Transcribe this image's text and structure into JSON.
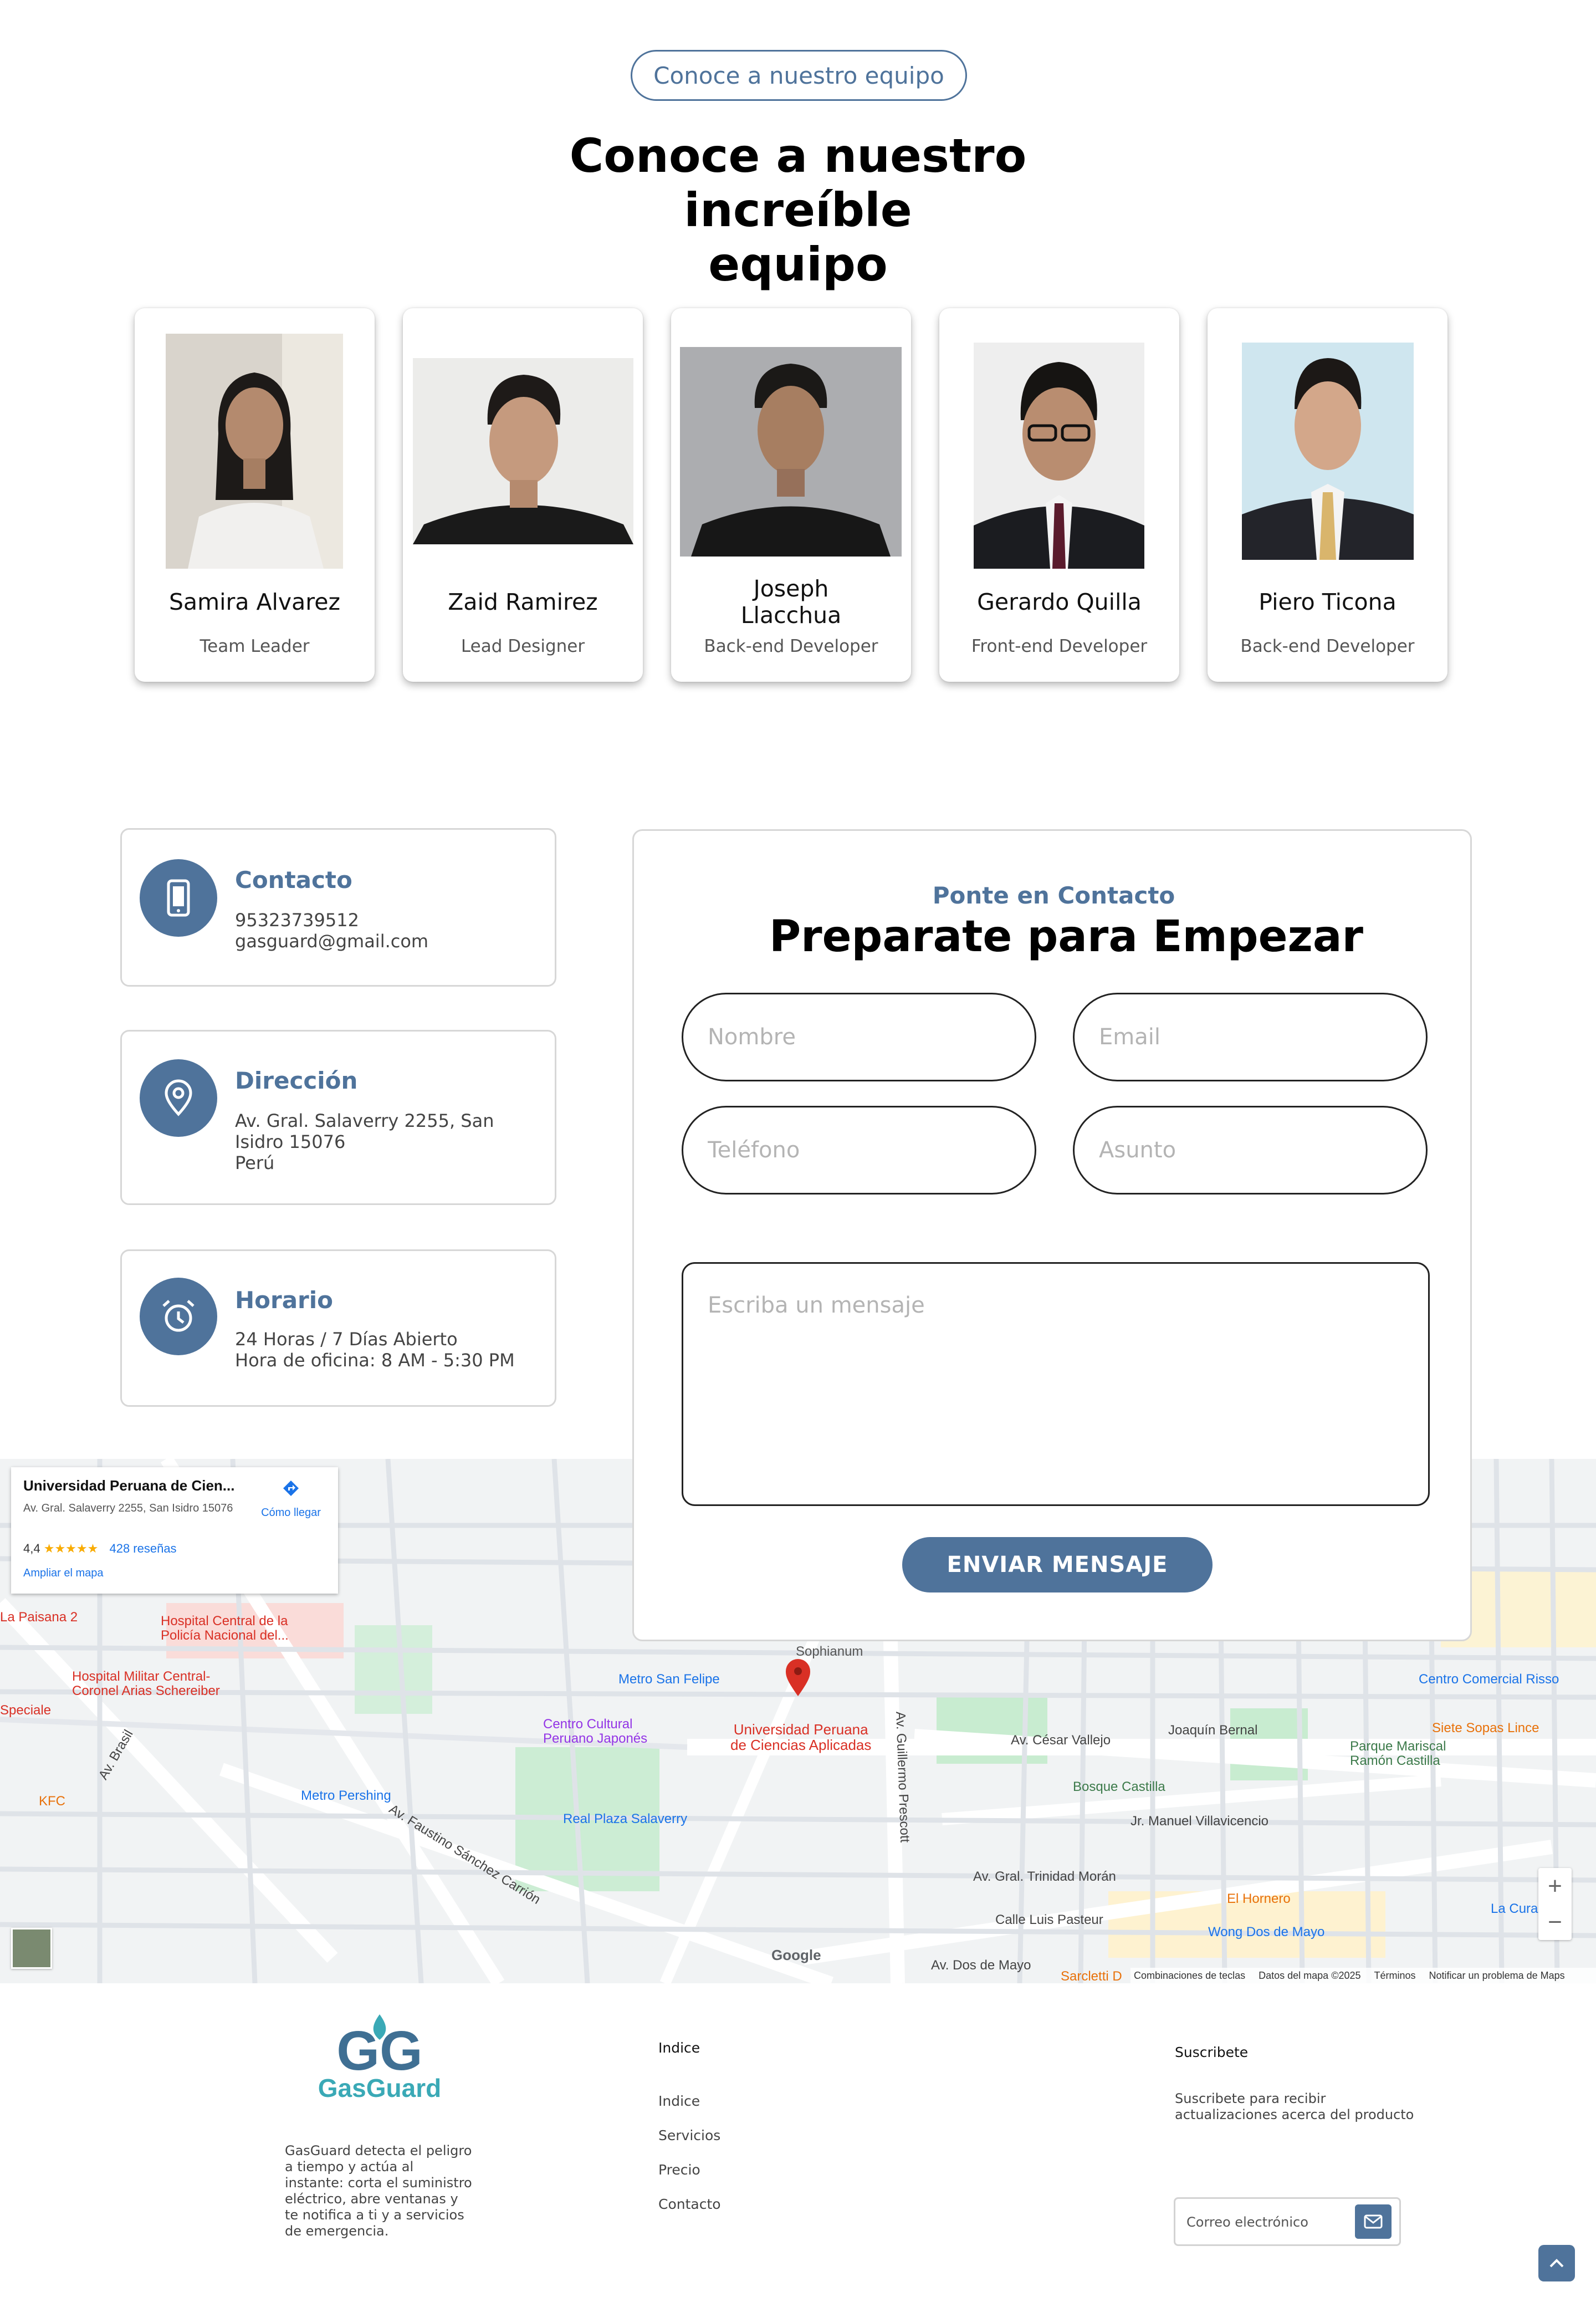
{
  "team": {
    "pill_label": "Conoce a nuestro equipo",
    "title_line1": "Conoce a nuestro increíble",
    "title_line2": "equipo",
    "members": [
      {
        "name_line1": "Samira Alvarez",
        "name_line2": "",
        "role": "Team Leader"
      },
      {
        "name_line1": "Zaid Ramirez",
        "name_line2": "",
        "role": "Lead Designer"
      },
      {
        "name_line1": "Joseph",
        "name_line2": "Llacchua",
        "role": "Back-end Developer"
      },
      {
        "name_line1": "Gerardo Quilla",
        "name_line2": "",
        "role": "Front-end Developer"
      },
      {
        "name_line1": "Piero Ticona",
        "name_line2": "",
        "role": "Back-end Developer"
      }
    ]
  },
  "contact_cards": {
    "contact": {
      "title": "Contacto",
      "line1": "95323739512",
      "line2": "gasguard@gmail.com"
    },
    "address": {
      "title": "Dirección",
      "line1": "Av. Gral. Salaverry 2255, San Isidro 15076",
      "line2": "Perú"
    },
    "hours": {
      "title": "Horario",
      "line1": "24 Horas / 7 Días Abierto",
      "line2": "Hora de oficina: 8 AM - 5:30 PM"
    }
  },
  "form": {
    "kicker": "Ponte en Contacto",
    "title": "Preparate para Empezar",
    "placeholders": {
      "name": "Nombre",
      "email": "Email",
      "phone": "Teléfono",
      "subject": "Asunto",
      "message": "Escriba un mensaje"
    },
    "submit": "ENVIAR MENSAJE"
  },
  "map": {
    "place_name": "Universidad Peruana de Cien...",
    "place_address": "Av. Gral. Salaverry 2255, San Isidro 15076",
    "rating": "4,4",
    "stars": "★★★★★",
    "reviews": "428 reseñas",
    "directions": "Cómo llegar",
    "expand": "Ampliar el mapa",
    "pin_label_line1": "Universidad Peruana",
    "pin_label_line2": "de Ciencias Aplicadas",
    "labels": {
      "hospital1": "Hospital Central de la Policía Nacional del...",
      "hospital2": "Hospital Militar Central- Coronel Arias Schereiber",
      "metro_sf": "Metro San Felipe",
      "metro_pershing": "Metro Pershing",
      "centro_cultural": "Centro Cultural Peruano Japonés",
      "real_plaza": "Real Plaza Salaverry",
      "bosque": "Bosque Castilla",
      "parque": "Parque Mariscal Ramón Castilla",
      "centro_risso": "Centro Comercial Risso",
      "siete_sopas": "Siete Sopas Lince",
      "el_hornero": "El Hornero",
      "wong": "Wong Dos de Mayo",
      "kfc": "KFC",
      "la_paisana": "La Paisana 2",
      "sophianum": "Sophianum",
      "av_cesar_vallejo": "Av. César Vallejo",
      "av_faustino": "Av. Faustino Sánchez Carrión",
      "av_dos_de_mayo": "Av. Dos de Mayo",
      "joaquin_bernal": "Joaquín Bernal",
      "av_brasil": "Av. Brasil",
      "jr_manuel": "Jr. Manuel Villavicencio",
      "av_trinidad": "Av. Gral. Trinidad Morán",
      "calle_luis": "Calle Luis Pasteur",
      "av_guillermo": "Av. Guillermo Prescott",
      "especiale": "Speciale",
      "la_cura": "La Cura",
      "sarcletti": "Sarcletti D"
    },
    "attribution": {
      "shortcuts": "Combinaciones de teclas",
      "data": "Datos del mapa ©2025",
      "terms": "Términos",
      "report": "Notificar un problema de Maps",
      "google": "Google"
    }
  },
  "footer": {
    "brand_letters": "GG",
    "brand_name": "GasGuard",
    "description": "GasGuard detecta el peligro a tiempo y actúa al instante: corta el suministro eléctrico, abre ventanas y te notifica a ti y a servicios de emergencia.",
    "index_heading": "Indice",
    "links": [
      "Indice",
      "Servicios",
      "Precio",
      "Contacto"
    ],
    "subscribe_heading": "Suscribete",
    "subscribe_text": "Suscribete para recibir actualizaciones acerca del producto",
    "email_placeholder": "Correo electrónico"
  },
  "colors": {
    "accent": "#4f739b",
    "pin": "#d93025",
    "park": "#c8ecd0",
    "road": "#ffffff"
  }
}
